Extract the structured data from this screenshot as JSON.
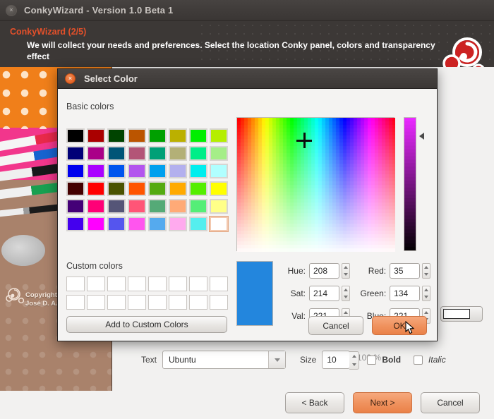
{
  "app": {
    "title": "ConkyWizard - Version 1.0 Beta 1",
    "close_icon": "×",
    "header_step": "ConkyWizard (2/5)",
    "header_desc": "We will collect your needs and preferences. Select the location Conky panel, colors and transparency effect",
    "side_copyright_line1": "Copyright",
    "side_copyright_line2": "José D. A.",
    "opacity_value": "100 %",
    "italic_label_right": "Italic"
  },
  "form": {
    "text_label": "Text",
    "font_value": "Ubuntu",
    "size_label": "Size",
    "size_value": "10",
    "bold_label": "Bold",
    "italic_label": "Italic"
  },
  "nav": {
    "back": "< Back",
    "next": "Next >",
    "cancel": "Cancel"
  },
  "dialog": {
    "title": "Select Color",
    "close_icon": "×",
    "basic_colors_label": "Basic colors",
    "custom_colors_label": "Custom colors",
    "add_custom_label": "Add to Custom Colors",
    "ok_label": "OK",
    "cancel_label": "Cancel",
    "selected_color": "#2386dd",
    "basic_colors": [
      [
        "#000000",
        "#aa0000",
        "#004400",
        "#bb5500",
        "#00a000",
        "#bbb000",
        "#00ee00",
        "#b5ee00"
      ],
      [
        "#000077",
        "#aa0088",
        "#005577",
        "#b35577",
        "#00a077",
        "#b3b077",
        "#00ee88",
        "#a5ee88"
      ],
      [
        "#0000ee",
        "#aa00ff",
        "#0055ee",
        "#b355ee",
        "#00a0ee",
        "#b3b0ee",
        "#00eeee",
        "#b0ffff"
      ],
      [
        "#440000",
        "#ff0000",
        "#4b5300",
        "#ff5500",
        "#55aa11",
        "#ffaa00",
        "#55ee00",
        "#ffff00"
      ],
      [
        "#440077",
        "#ff0077",
        "#555577",
        "#ff5577",
        "#55aa77",
        "#ffaa77",
        "#55ee77",
        "#ffff88"
      ],
      [
        "#4400ee",
        "#ff00ff",
        "#5555ee",
        "#ff55ee",
        "#55aaee",
        "#ffaaee",
        "#55eeee",
        "#ffffff"
      ]
    ],
    "custom_rows": 2,
    "custom_cols": 8,
    "fields": {
      "hue": {
        "label": "Hue:",
        "value": "208"
      },
      "sat": {
        "label": "Sat:",
        "value": "214"
      },
      "val": {
        "label": "Val:",
        "value": "221"
      },
      "red": {
        "label": "Red:",
        "value": "35"
      },
      "green": {
        "label": "Green:",
        "value": "134"
      },
      "blue": {
        "label": "Blue:",
        "value": "221"
      }
    }
  }
}
